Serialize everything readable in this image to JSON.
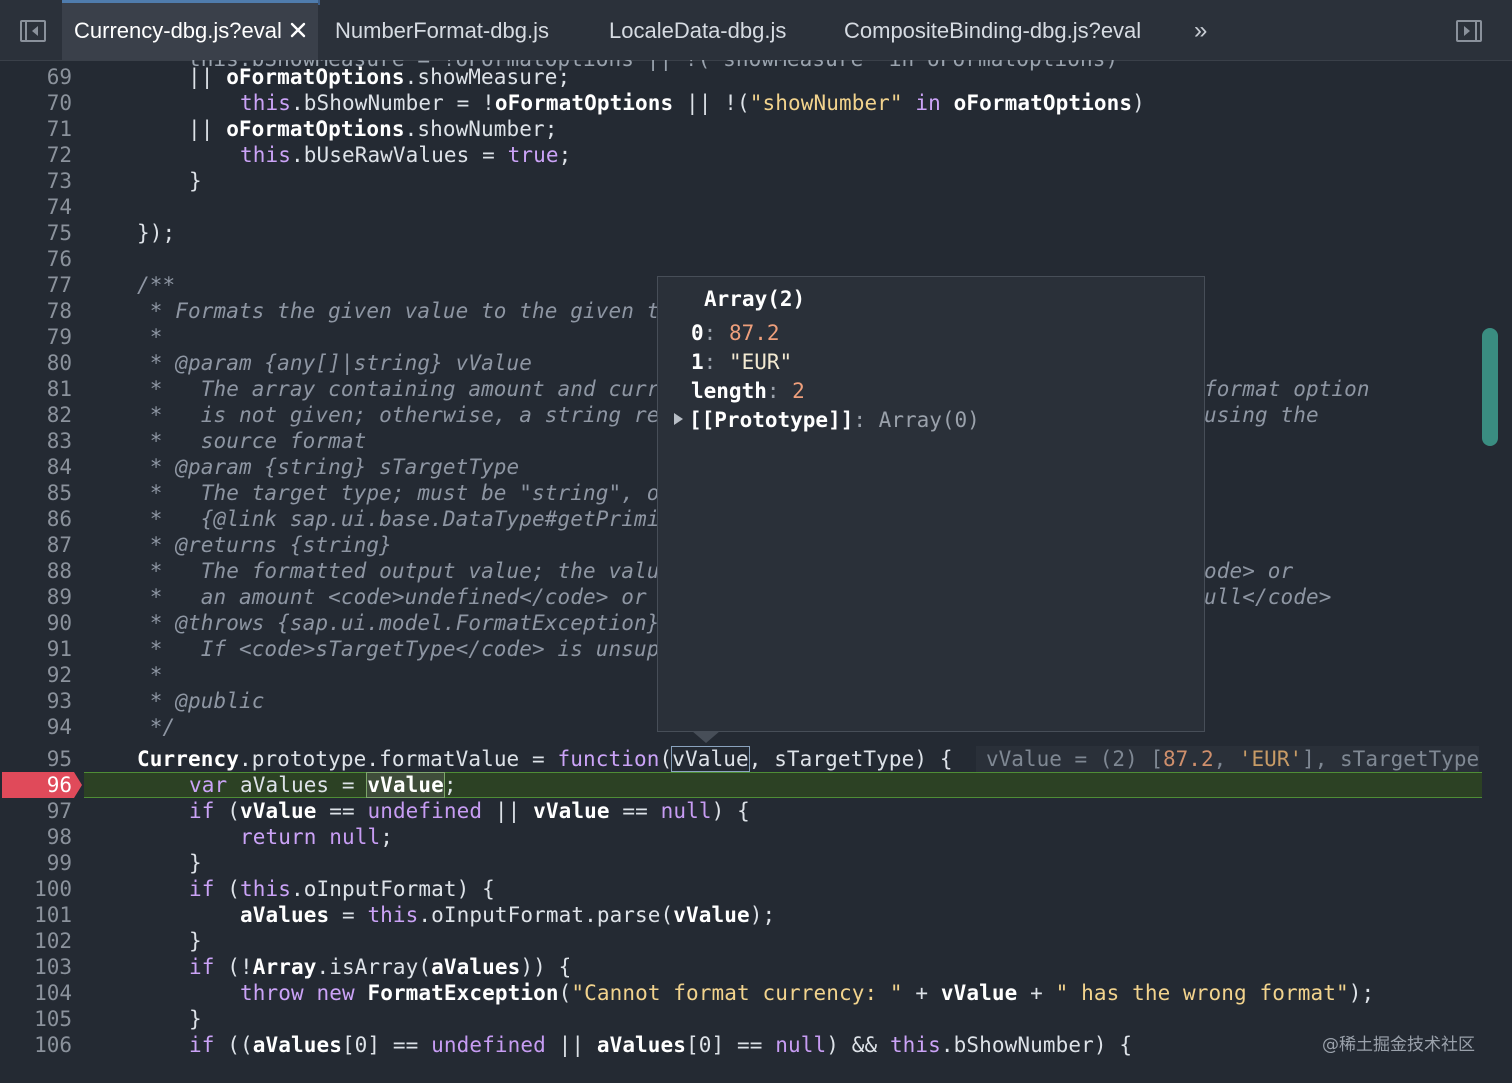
{
  "tabs": [
    {
      "label": "Currency-dbg.js?eval",
      "active": true
    },
    {
      "label": "NumberFormat-dbg.js",
      "active": false
    },
    {
      "label": "LocaleData-dbg.js",
      "active": false
    },
    {
      "label": "CompositeBinding-dbg.js?eval",
      "active": false
    }
  ],
  "more_tabs_glyph": "»",
  "icons": {
    "left_panel": "toggle-navigator-icon",
    "right_panel": "toggle-debugger-sidebar-icon",
    "close": "close-icon",
    "breakpoint": "breakpoint-marker-icon",
    "expand": "expand-triangle-icon"
  },
  "colors": {
    "editor_bg": "#242a33",
    "keyword": "#cba3f7",
    "string": "#f2d38d",
    "number": "#ee9f7c",
    "comment": "#8e96a3",
    "breakpoint": "#e04a5a",
    "execution_line": "#2c4124",
    "scrollbar": "#3a8d81"
  },
  "line_numbers": [
    "69",
    "70",
    "71",
    "72",
    "73",
    "74",
    "75",
    "76",
    "77",
    "78",
    "79",
    "80",
    "81",
    "82",
    "83",
    "84",
    "85",
    "86",
    "87",
    "88",
    "89",
    "90",
    "91",
    "92",
    "93",
    "94",
    "95",
    "96",
    "97",
    "98",
    "99",
    "100",
    "101",
    "102",
    "103",
    "104",
    "105",
    "106"
  ],
  "paused_line": "96",
  "code": {
    "l69_a": "        || ",
    "l69_b": "oFormatOptions",
    "l69_c": ".showMeasure;",
    "l70_a": "this",
    "l70_b": ".bShowNumber = !",
    "l70_c": "oFormatOptions",
    "l70_d": " || !(",
    "l70_e": "\"showNumber\"",
    "l70_f": " in ",
    "l70_g": "oFormatOptions",
    "l70_h": ")",
    "l71_a": "        || ",
    "l71_b": "oFormatOptions",
    "l71_c": ".showNumber;",
    "l72_a": "this",
    "l72_b": ".bUseRawValues = ",
    "l72_c": "true",
    "l72_d": ";",
    "l73": "}",
    "l75": "});",
    "l77": "/**",
    "l78": " * Formats the given value to the given t",
    "l79": " *",
    "l80": " * @param {any[]|string} vValue",
    "l81": " *   The array containing amount and curr",
    "l81_r": "format option",
    "l82": " *   is not given; otherwise, a string re",
    "l82_r": "using the",
    "l83": " *   source format",
    "l84": " * @param {string} sTargetType",
    "l85": " *   The target type; must be \"string\", o",
    "l86": " *   {@link sap.ui.base.DataType#getPrimi",
    "l87": " * @returns {string}",
    "l88": " *   The formatted output value; the valu",
    "l88_r": "ode> or",
    "l89": " *   an amount <code>undefined</code> or ",
    "l89_r": "ull</code>",
    "l90": " * @throws {sap.ui.model.FormatException}",
    "l91": " *   If <code>sTargetType</code> is unsup",
    "l92": " *",
    "l93": " * @public",
    "l94": " */",
    "l95_a": "Currency",
    "l95_b": ".prototype.formatValue = ",
    "l95_c": "function",
    "l95_d": "(",
    "l95_e": "vValue",
    "l95_f": ", sTargetType) {",
    "l95_inline_a": "vValue = (2) [",
    "l95_inline_b": "87.2",
    "l95_inline_c": ", ",
    "l95_inline_d": "'EUR'",
    "l95_inline_e": "], sTargetType",
    "l96_a": "var",
    "l96_b": " aValues = ",
    "l96_c": "vValue",
    "l96_d": ";",
    "l97_a": "if",
    "l97_b": " (",
    "l97_c": "vValue",
    "l97_d": " == ",
    "l97_e": "undefined",
    "l97_f": " || ",
    "l97_g": "vValue",
    "l97_h": " == ",
    "l97_i": "null",
    "l97_j": ") {",
    "l98_a": "return",
    "l98_b": " ",
    "l98_c": "null",
    "l98_d": ";",
    "l99": "}",
    "l100_a": "if",
    "l100_b": " (",
    "l100_c": "this",
    "l100_d": ".oInputFormat) {",
    "l101_a": "aValues",
    "l101_b": " = ",
    "l101_c": "this",
    "l101_d": ".oInputFormat.parse(",
    "l101_e": "vValue",
    "l101_f": ");",
    "l102": "}",
    "l103_a": "if",
    "l103_b": " (!",
    "l103_c": "Array",
    "l103_d": ".isArray(",
    "l103_e": "aValues",
    "l103_f": ")) {",
    "l104_a": "throw",
    "l104_b": " ",
    "l104_c": "new",
    "l104_d": " ",
    "l104_e": "FormatException",
    "l104_f": "(",
    "l104_g": "\"Cannot format currency: \"",
    "l104_h": " + ",
    "l104_i": "vValue",
    "l104_j": " + ",
    "l104_k": "\" has the wrong format\"",
    "l104_l": ");",
    "l105": "}",
    "l106_a": "if",
    "l106_b": " ((",
    "l106_c": "aValues",
    "l106_d": "[0] == ",
    "l106_e": "undefined",
    "l106_f": " || ",
    "l106_g": "aValues",
    "l106_h": "[0] == ",
    "l106_i": "null",
    "l106_j": ") && ",
    "l106_k": "this",
    "l106_l": ".bShowNumber) {"
  },
  "popover": {
    "title": "Array(2)",
    "entries": [
      {
        "key": "0",
        "sep": ": ",
        "value": "87.2"
      },
      {
        "key": "1",
        "sep": ": ",
        "value": "\"EUR\""
      },
      {
        "key": "length",
        "sep": ": ",
        "value": "2"
      }
    ],
    "prototype_key": "[[Prototype]]",
    "prototype_sep": ": ",
    "prototype_value": "Array(0)"
  },
  "watermark": "@稀土掘金技术社区"
}
